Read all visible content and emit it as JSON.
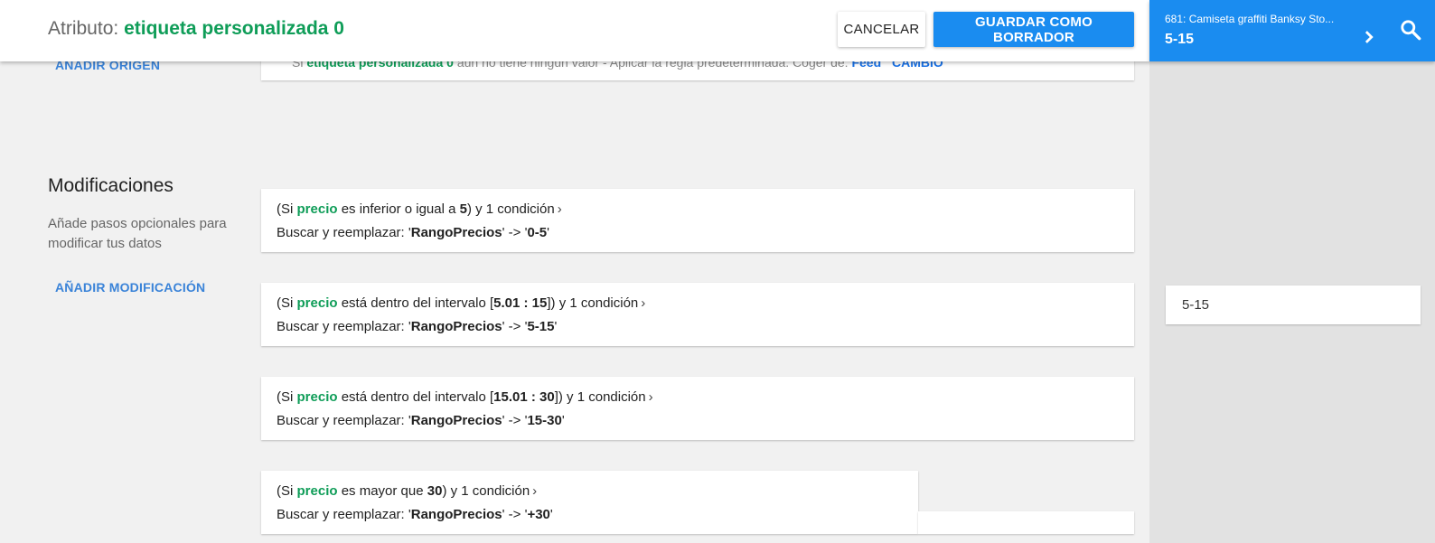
{
  "header": {
    "title_prefix": "Atributo:",
    "attribute_name": "etiqueta personalizada 0",
    "cancel_label": "CANCELAR",
    "save_label": "GUARDAR COMO BORRADOR"
  },
  "preview": {
    "product": "681: Camiseta graffiti Banksy Sto...",
    "value": "5-15",
    "icons": {
      "next": "chevron-right-icon",
      "search": "search-icon"
    },
    "result_value": "5-15"
  },
  "source": {
    "add_origin_label": "AÑADIR ORIGEN",
    "fallback_text_prefix": "Si",
    "fallback_attr": "etiqueta personalizada 0",
    "fallback_text": "aún no tiene ningún valor - Aplicar la regla predeterminada. Coger de:",
    "fallback_source": "Feed",
    "change_label": "CAMBIO"
  },
  "modifications": {
    "title": "Modificaciones",
    "description": "Añade pasos opcionales para modificar tus datos",
    "add_label": "AÑADIR MODIFICACIÓN",
    "items": [
      {
        "open": "(Si",
        "field": "precio",
        "operator": "es inferior o igual a",
        "value": "5",
        "close": ") y 1 condición",
        "action": "Buscar y reemplazar:",
        "target": "RangoPrecios",
        "arrow": "->",
        "replacement": "0-5"
      },
      {
        "open": "(Si",
        "field": "precio",
        "operator": "está dentro del intervalo",
        "value": "5.01 : 15",
        "close": ") y 1 condición",
        "action": "Buscar y reemplazar:",
        "target": "RangoPrecios",
        "arrow": "->",
        "replacement": "5-15"
      },
      {
        "open": "(Si",
        "field": "precio",
        "operator": "está dentro del intervalo",
        "value": "15.01 : 30",
        "close": ") y 1 condición",
        "action": "Buscar y reemplazar:",
        "target": "RangoPrecios",
        "arrow": "->",
        "replacement": "15-30"
      },
      {
        "open": "(Si",
        "field": "precio",
        "operator": "es mayor que",
        "value": "30",
        "close": ") y 1 condición",
        "action": "Buscar y reemplazar:",
        "target": "RangoPrecios",
        "arrow": "->",
        "replacement": "+30"
      }
    ]
  },
  "colors": {
    "accent_blue": "#1a8cf0",
    "attribute_green": "#0f9d58",
    "link_blue": "#3a83d8",
    "page_bg": "#f1f1f1",
    "preview_column_bg": "#e2e2e2"
  }
}
